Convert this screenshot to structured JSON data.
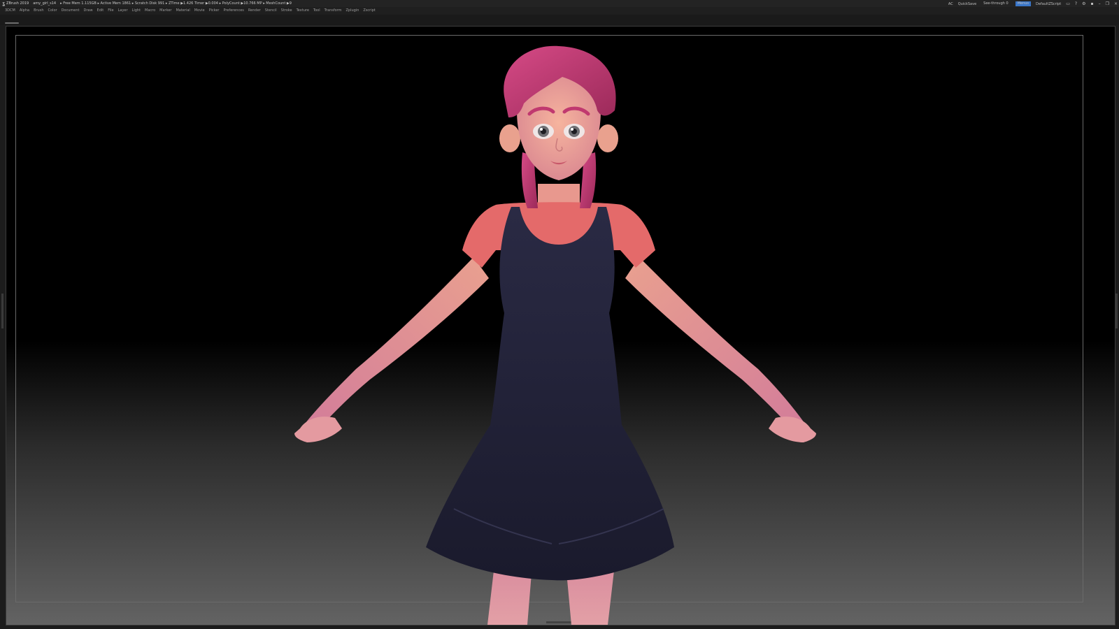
{
  "titlebar": {
    "logo_icon": "zbrush-logo-icon",
    "app_title": "ZBrush 2019",
    "file_name": "amy_girl_s14",
    "status": "▸ Free Mem 1.115GB ▸ Active Mem 1861 ▸ Scratch Disk 991 ▸ ZTime ▶1.426 Timer ▶0.004 ▸ PolyCount ▶10.766 MP ▸ MeshCount ▶9",
    "ac": "AC",
    "quicksave": "QuickSave",
    "seethrough": "See-through 0",
    "menus": "Menus",
    "script": "DefaultZScript",
    "right_icons": [
      "layout-icon",
      "help-icon",
      "settings-icon",
      "lock-icon",
      "minimize-icon",
      "restore-icon",
      "close-icon"
    ]
  },
  "menubar": {
    "items": [
      "3DCM",
      "Alpha",
      "Brush",
      "Color",
      "Document",
      "Draw",
      "Edit",
      "File",
      "Layer",
      "Light",
      "Macro",
      "Marker",
      "Material",
      "Movie",
      "Picker",
      "Preferences",
      "Render",
      "Stencil",
      "Stroke",
      "Texture",
      "Tool",
      "Transform",
      "Zplugin",
      "Zscript"
    ]
  },
  "colors": {
    "skin": "#e8908c",
    "hair": "#c0396f",
    "dress": "#22223a",
    "shirt": "#e46a6a"
  }
}
